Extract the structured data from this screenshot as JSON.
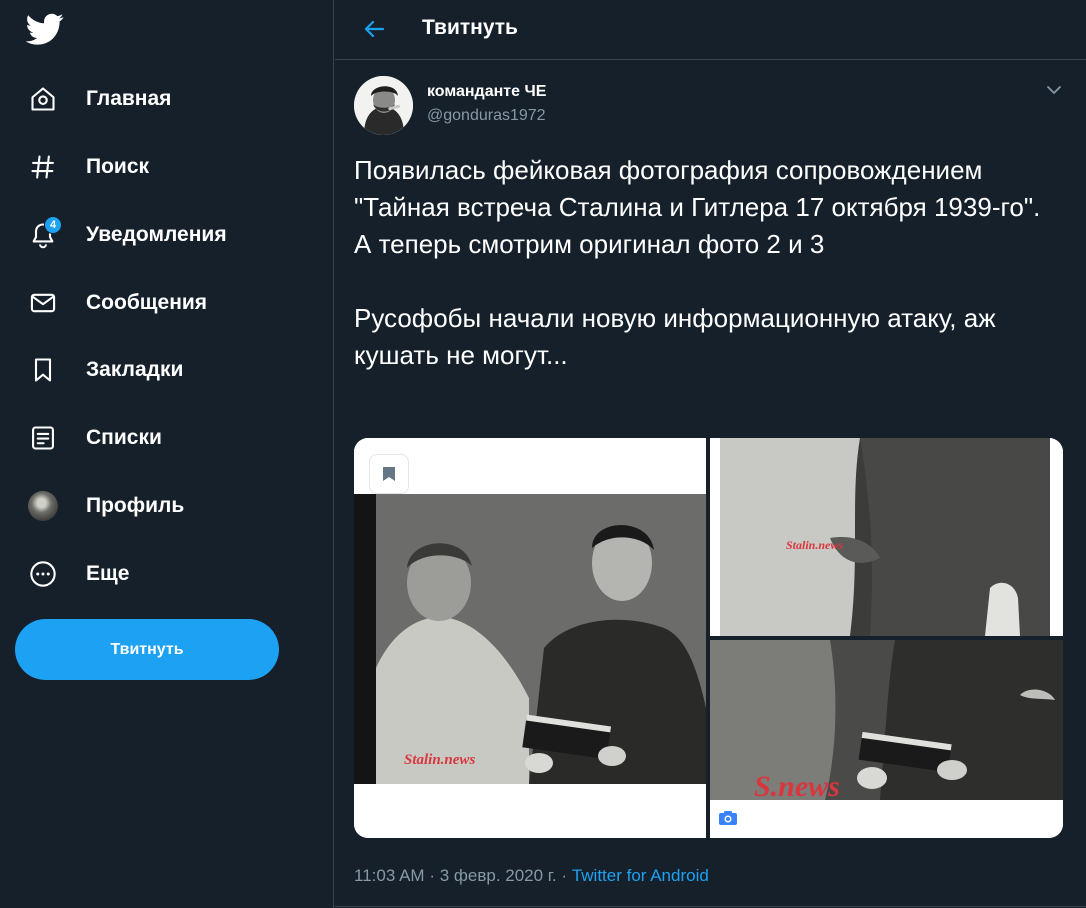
{
  "sidebar": {
    "logo": "twitter-bird-icon",
    "items": [
      {
        "label": "Главная",
        "icon": "home-icon"
      },
      {
        "label": "Поиск",
        "icon": "hashtag-icon"
      },
      {
        "label": "Уведомления",
        "icon": "bell-icon",
        "badge": "4"
      },
      {
        "label": "Сообщения",
        "icon": "envelope-icon"
      },
      {
        "label": "Закладки",
        "icon": "bookmark-icon"
      },
      {
        "label": "Списки",
        "icon": "list-icon"
      },
      {
        "label": "Профиль",
        "icon": "avatar"
      },
      {
        "label": "Еще",
        "icon": "more-circle-icon"
      }
    ],
    "tweet_button": "Твитнуть"
  },
  "header": {
    "title": "Твитнуть",
    "back_icon": "arrow-left-icon"
  },
  "tweet": {
    "author_name": "команданте ЧЕ",
    "author_handle": "@gonduras1972",
    "text": "Появилась фейковая фотография сопровождением \"Тайная встреча Сталина и Гитлера 17 октября 1939-го\".\nА теперь смотрим оригинал фото 2 и 3\n\nРусофобы начали новую информационную атаку, аж кушать не могут...",
    "media": {
      "watermark_1": "Stalin.news",
      "watermark_2": "Stalin.news",
      "watermark_3": "S.news"
    },
    "time": "11:03 AM",
    "date": "3 февр. 2020 г.",
    "separator": "·",
    "source": "Twitter for Android"
  },
  "colors": {
    "background": "#15202b",
    "accent": "#1da1f2",
    "muted": "#8899a6",
    "border": "#38444d",
    "watermark": "#d9363e"
  }
}
